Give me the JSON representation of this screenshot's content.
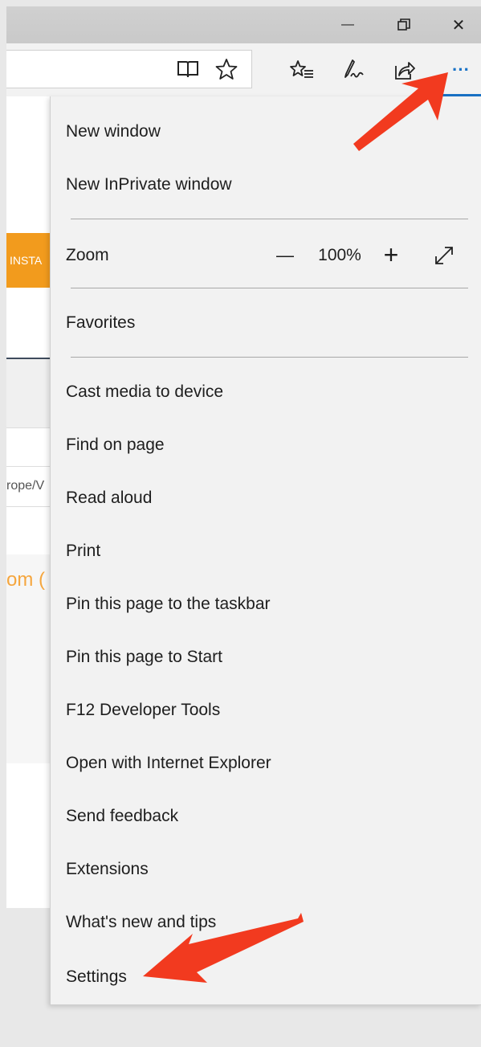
{
  "page": {
    "insta_text": "INSTA",
    "url_fragment": "rope/V",
    "orange_fragment": "om ("
  },
  "titlebar": {
    "minimize_glyph": "—",
    "restore_glyph": "❐",
    "close_glyph": "✕"
  },
  "toolbar": {
    "more_glyph": "···"
  },
  "menu": {
    "new_window": "New window",
    "new_inprivate": "New InPrivate window",
    "zoom_label": "Zoom",
    "zoom_value": "100%",
    "zoom_minus": "—",
    "zoom_plus": "+",
    "favorites": "Favorites",
    "cast_media": "Cast media to device",
    "find_on_page": "Find on page",
    "read_aloud": "Read aloud",
    "print": "Print",
    "pin_taskbar": "Pin this page to the taskbar",
    "pin_start": "Pin this page to Start",
    "dev_tools": "F12 Developer Tools",
    "open_ie": "Open with Internet Explorer",
    "send_feedback": "Send feedback",
    "extensions": "Extensions",
    "whats_new": "What's new and tips",
    "settings": "Settings"
  },
  "colors": {
    "accent_blue": "#1a73c7",
    "arrow_red": "#f23a1f",
    "orange": "#f29b1d"
  }
}
